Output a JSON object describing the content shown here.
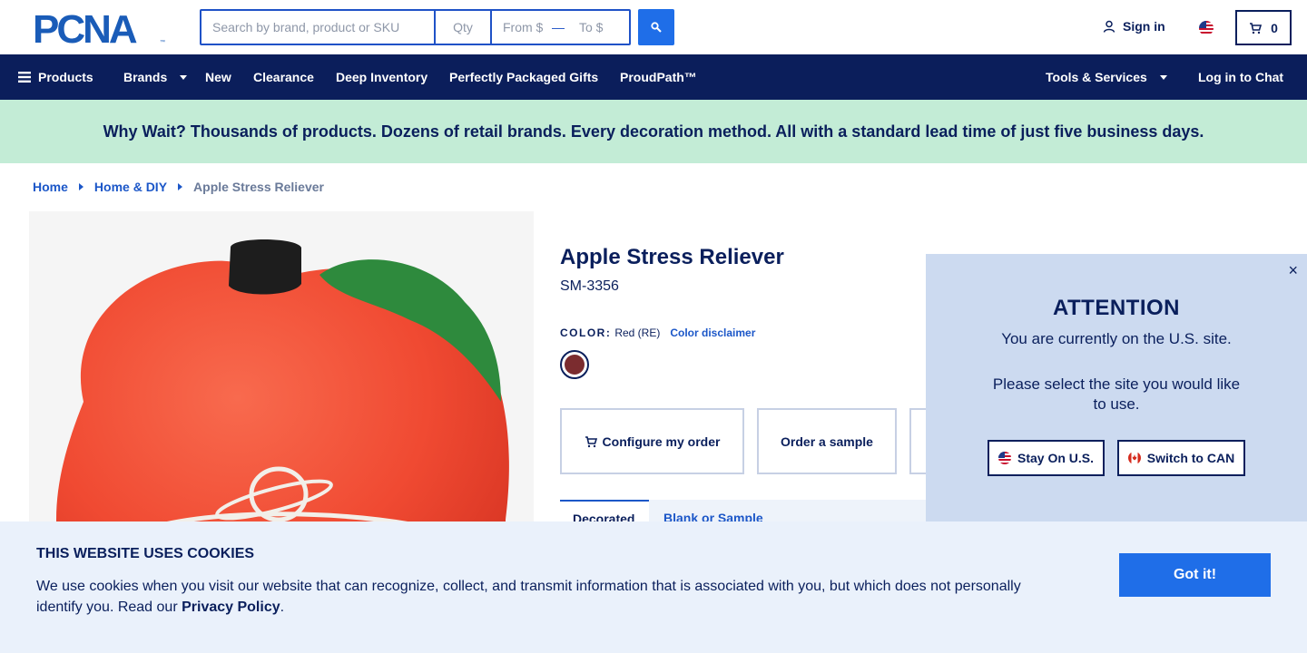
{
  "header": {
    "logo_text": "PCNA",
    "search_placeholder": "Search by brand, product or SKU",
    "qty_placeholder": "Qty",
    "price_from_placeholder": "From $",
    "price_to_placeholder": "To $",
    "price_separator": "—",
    "search_icon": "search-icon",
    "signin_label": "Sign in",
    "cart_count": "0"
  },
  "nav": {
    "products": "Products",
    "brands": "Brands",
    "new": "New",
    "clearance": "Clearance",
    "deep_inventory": "Deep Inventory",
    "gifts": "Perfectly Packaged Gifts",
    "proudpath": "ProudPath™",
    "tools": "Tools & Services",
    "chat": "Log in to Chat"
  },
  "banner": {
    "text": "Why Wait? Thousands of products. Dozens of retail brands. Every decoration method. All with a standard lead time of just five business days."
  },
  "breadcrumb": {
    "home": "Home",
    "category": "Home & DIY",
    "current": "Apple Stress Reliever"
  },
  "product": {
    "title": "Apple Stress Reliever",
    "sku": "SM-3356",
    "color_label": "COLOR:",
    "color_value": "Red (RE)",
    "color_disclaimer": "Color disclaimer",
    "swatch_color": "#7b2c2f",
    "configure_label": "Configure my order",
    "sample_label": "Order a sample",
    "tab_active": "Decorated",
    "tab_inactive": "Blank or Sample"
  },
  "popup": {
    "close": "×",
    "heading": "ATTENTION",
    "line1": "You are currently on the U.S. site.",
    "line2": "Please select the site you would like to use.",
    "stay_label": "Stay On U.S.",
    "switch_label": "Switch to CAN"
  },
  "cookie": {
    "title": "THIS WEBSITE USES COOKIES",
    "text_before": "We use cookies when you visit our website that can recognize, collect, and transmit information that is associated with you, but which does not personally identify you. Read our ",
    "link": "Privacy Policy",
    "text_after": ".",
    "button": "Got it!"
  },
  "colors": {
    "navy": "#0b1e5b",
    "accent_blue": "#1f6ee8",
    "banner_green": "#c3ecd6",
    "popup_bg": "#ccdaf0",
    "cookie_bg": "#eaf1fb"
  }
}
